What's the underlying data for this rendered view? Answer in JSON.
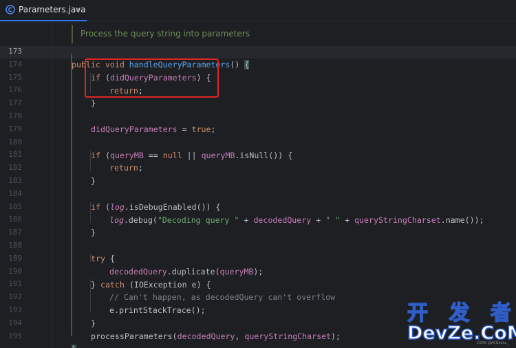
{
  "tab": {
    "label": "Parameters.java",
    "close": "×",
    "icon": "java-class-icon",
    "accent": "#3574f0"
  },
  "doc_comment": "Process the query string into parameters",
  "lines": [
    {
      "n": "173",
      "active": true
    },
    {
      "n": "174"
    },
    {
      "n": "175"
    },
    {
      "n": "176"
    },
    {
      "n": "177"
    },
    {
      "n": "178"
    },
    {
      "n": "179"
    },
    {
      "n": "180"
    },
    {
      "n": "181"
    },
    {
      "n": "182"
    },
    {
      "n": "183"
    },
    {
      "n": "184"
    },
    {
      "n": "185"
    },
    {
      "n": "186"
    },
    {
      "n": "187"
    },
    {
      "n": "188"
    },
    {
      "n": "189"
    },
    {
      "n": "190"
    },
    {
      "n": "191"
    },
    {
      "n": "192"
    },
    {
      "n": "193"
    },
    {
      "n": "194"
    },
    {
      "n": "195"
    }
  ],
  "code": {
    "l173": {
      "kw1": "public",
      "kw2": "void",
      "fn": "handleQueryParameters",
      "rest": "() ",
      "brace": "{"
    },
    "l174": {
      "kw": "if",
      "p1": " (",
      "fld": "didQueryParameters",
      "p2": ") {"
    },
    "l175": {
      "kw": "return",
      "p": ";"
    },
    "l176": {
      "p": "}"
    },
    "l178": {
      "fld": "didQueryParameters",
      "p1": " = ",
      "kw": "true",
      "p2": ";"
    },
    "l180": {
      "kw": "if",
      "p1": " (",
      "fld1": "queryMB",
      "p2": " == ",
      "kw2": "null",
      "p3": " || ",
      "fld2": "queryMB",
      "p4": ".isNull()) {"
    },
    "l181": {
      "kw": "return",
      "p": ";"
    },
    "l182": {
      "p": "}"
    },
    "l184": {
      "kw": "if",
      "p1": " (",
      "it": "log",
      "p2": ".isDebugEnabled()) {"
    },
    "l185": {
      "it": "log",
      "p1": ".debug(",
      "s1": "\"Decoding query \"",
      "p2": " + ",
      "fld1": "decodedQuery",
      "p3": " + ",
      "s2": "\" \"",
      "p4": " + ",
      "fld2": "queryStringCharset",
      "p5": ".name());"
    },
    "l186": {
      "p": "}"
    },
    "l188": {
      "kw": "try",
      "p": " {"
    },
    "l189": {
      "fld1": "decodedQuery",
      "p1": ".duplicate(",
      "fld2": "queryMB",
      "p2": ");"
    },
    "l190": {
      "p1": "} ",
      "kw": "catch",
      "p2": " (IOException e) {"
    },
    "l191": {
      "cmt": "// Can't happen, as decodedQuery can't overflow"
    },
    "l192": {
      "p": "e.printStackTrace();"
    },
    "l193": {
      "p": "}"
    },
    "l194": {
      "p1": "processParameters(",
      "fld1": "decodedQuery",
      "p2": ", ",
      "fld2": "queryStringCharset",
      "p3": ");"
    },
    "l195": {
      "brace": "}"
    }
  },
  "colors": {
    "background": "#1e1f22",
    "keyword": "#cf8e6d",
    "field": "#c77dbb",
    "method": "#56a8f5",
    "string": "#6aab73",
    "comment": "#7a7e85",
    "highlight_box": "#e02424"
  },
  "watermark": {
    "top": "开 发 者",
    "bottom": "DevZe.CoM",
    "tiny": "CSDN @ACGkaka_"
  }
}
